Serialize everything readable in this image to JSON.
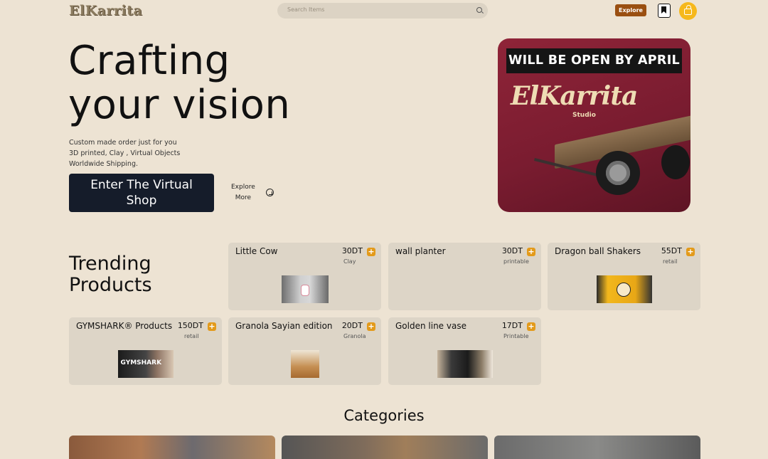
{
  "header": {
    "logo": "ElKarrita",
    "search_placeholder": "Search Items",
    "explore_label": "Explore"
  },
  "hero": {
    "title_line1": "Crafting",
    "title_line2": "your vision",
    "description": [
      "Custom made order just for you",
      "3D printed, Clay , Virtual Objects",
      "Worldwide Shipping."
    ],
    "cta_line1": "Enter The Virtual",
    "cta_line2": "Shop",
    "explore_line1": "Explore",
    "explore_line2": "More"
  },
  "promo": {
    "banner": "WILL BE OPEN BY APRIL",
    "logo": "ElKarrita",
    "subtitle": "Studio"
  },
  "trending": {
    "title_line1": "Trending",
    "title_line2": "Products",
    "products": [
      {
        "name": "Little Cow",
        "price": "30DT",
        "category": "Clay"
      },
      {
        "name": "wall planter",
        "price": "30DT",
        "category": "printable"
      },
      {
        "name": "Dragon ball Shakers",
        "price": "55DT",
        "category": "retail"
      },
      {
        "name": "GYMSHARK® Products",
        "price": "150DT",
        "category": "retail",
        "image_text": "GYMSHARK"
      },
      {
        "name": "Granola Sayian edition",
        "price": "20DT",
        "category": "Granola"
      },
      {
        "name": "Golden line vase",
        "price": "17DT",
        "category": "Printable"
      }
    ]
  },
  "categories": {
    "title": "Categories"
  },
  "colors": {
    "background": "#ede3d3",
    "card": "#ddd5c7",
    "accent_orange": "#9a4f11",
    "accent_yellow": "#f6b81c",
    "cta_dark": "#151c2a"
  }
}
